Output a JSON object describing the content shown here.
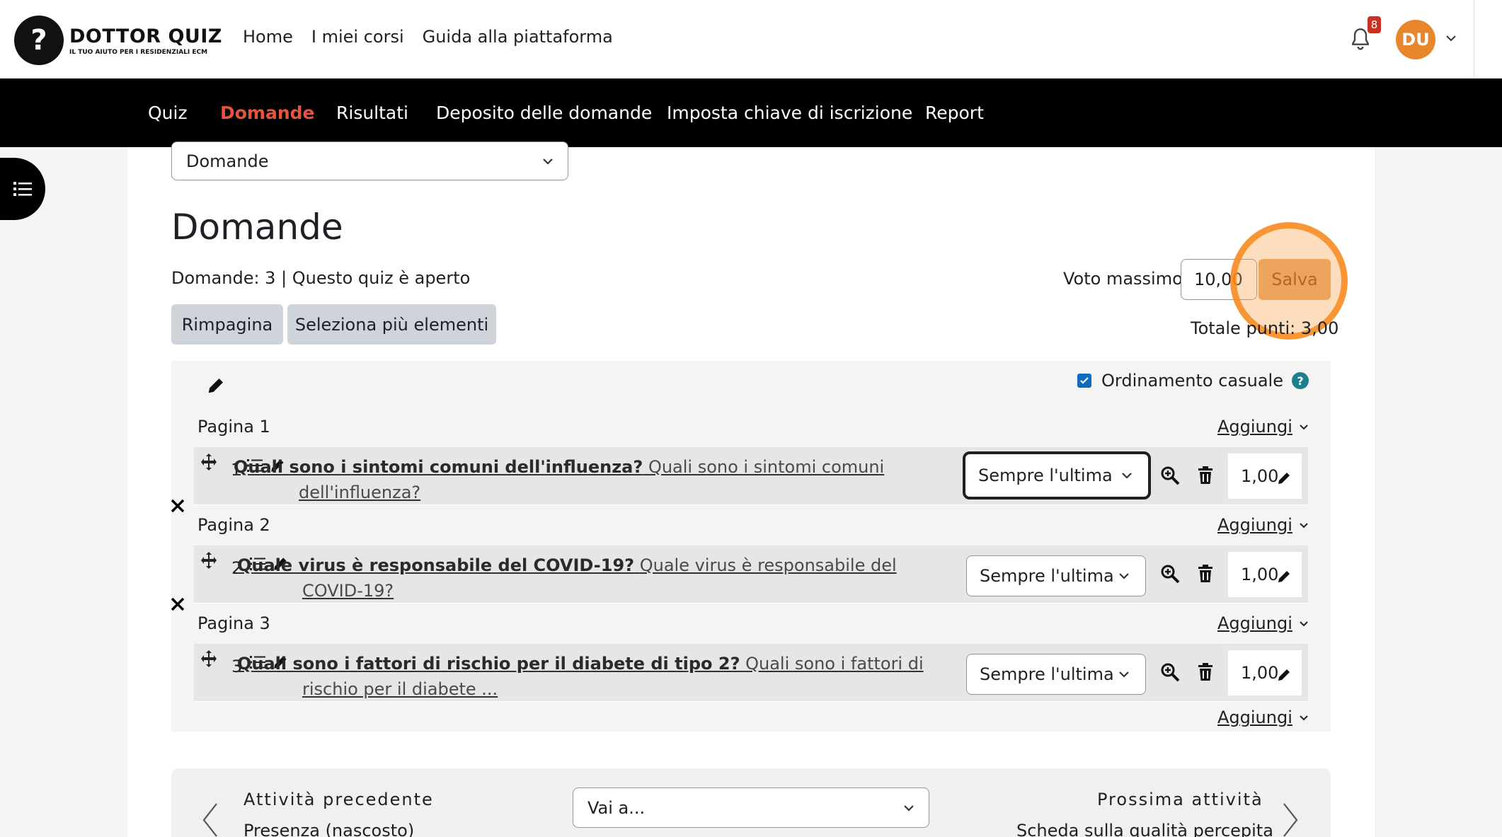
{
  "brand": {
    "initial": "?",
    "name": "DOTTOR QUIZ",
    "tagline": "IL TUO AIUTO PER I RESIDENZIALI ECM"
  },
  "primary_nav": [
    "Home",
    "I miei corsi",
    "Guida alla piattaforma"
  ],
  "notifications": {
    "count": "8"
  },
  "user": {
    "initials": "DU"
  },
  "secondary_nav": [
    {
      "label": "Quiz",
      "active": false
    },
    {
      "label": "Domande",
      "active": true
    },
    {
      "label": "Risultati",
      "active": false
    },
    {
      "label": "Deposito delle domande",
      "active": false
    },
    {
      "label": "Imposta chiave di iscrizione",
      "active": false
    },
    {
      "label": "Report",
      "active": false
    }
  ],
  "page_select": {
    "value": "Domande"
  },
  "heading": "Domande",
  "meta": "Domande: 3 | Questo quiz è aperto",
  "buttons": {
    "repaginate": "Rimpagina",
    "select_multiple": "Seleziona più elementi"
  },
  "max_grade": {
    "label": "Voto massimo",
    "value": "10,00",
    "save": "Salva"
  },
  "total": "Totale punti: 3,00",
  "shuffle": {
    "label": "Ordinamento casuale",
    "checked": true,
    "help": "?"
  },
  "add_label": "Aggiungi",
  "pages": [
    {
      "label": "Pagina 1",
      "question": {
        "number": "1",
        "title": "Quali sono i sintomi comuni dell'influenza?",
        "text": "Quali sono i sintomi comuni dell'influenza?",
        "behaviour": "Sempre l'ultima",
        "mark": "1,00"
      }
    },
    {
      "label": "Pagina 2",
      "question": {
        "number": "2",
        "title": "Quale virus è responsabile del COVID-19?",
        "text": "Quale virus è responsabile del COVID-19?",
        "behaviour": "Sempre l'ultima",
        "mark": "1,00"
      }
    },
    {
      "label": "Pagina 3",
      "question": {
        "number": "3",
        "title": "Quali sono i fattori di rischio per il diabete di tipo 2?",
        "text": "Quali sono i fattori di rischio per il diabete ...",
        "behaviour": "Sempre l'ultima",
        "mark": "1,00"
      }
    }
  ],
  "activity_nav": {
    "prev_label": "Attività precedente",
    "prev_link": "Presenza (nascosto)",
    "jump": "Vai a...",
    "next_label": "Prossima attività",
    "next_link": "Scheda sulla qualità percepita"
  },
  "colors": {
    "accent": "#e8543b",
    "save": "#e9a86a",
    "highlight": "#f78a1e",
    "avatar": "#e8862b",
    "badge": "#ca3120",
    "checkbox": "#0f6cbf"
  }
}
